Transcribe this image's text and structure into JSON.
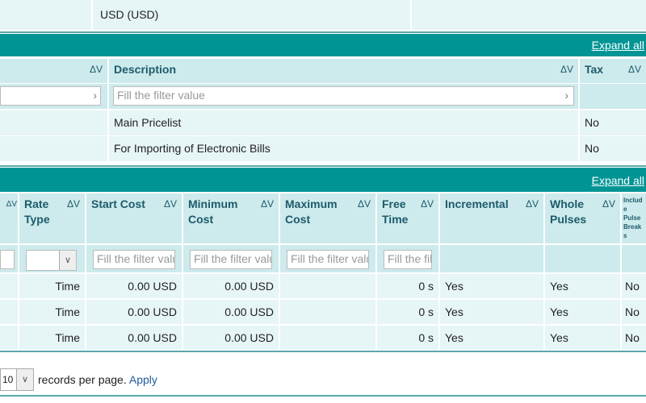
{
  "top": {
    "currency": "USD (USD)"
  },
  "pricelists": {
    "expand_all": "Expand all",
    "sort_icon": "ΔV",
    "columns": [
      "",
      "Description",
      "Tax"
    ],
    "filter_placeholder": "Fill the filter value",
    "rows": [
      {
        "description": "Main Pricelist",
        "tax": "No"
      },
      {
        "description": "For Importing of Electronic Bills",
        "tax": "No"
      }
    ]
  },
  "rates": {
    "expand_all": "Expand all",
    "sort_icon": "ΔV",
    "columns": [
      "",
      "Rate Type",
      "Start Cost",
      "Minimum Cost",
      "Maximum Cost",
      "Free Time",
      "Incremental",
      "Whole Pulses",
      "Include Pulse Breaks"
    ],
    "filter_placeholder": "Fill the filter value",
    "rows": [
      {
        "rate_type": "Time",
        "start_cost": "0.00 USD",
        "min_cost": "0.00 USD",
        "max_cost": "",
        "free_time": "0 s",
        "incremental": "Yes",
        "whole_pulses": "Yes",
        "incl": "No"
      },
      {
        "rate_type": "Time",
        "start_cost": "0.00 USD",
        "min_cost": "0.00 USD",
        "max_cost": "",
        "free_time": "0 s",
        "incremental": "Yes",
        "whole_pulses": "Yes",
        "incl": "No"
      },
      {
        "rate_type": "Time",
        "start_cost": "0.00 USD",
        "min_cost": "0.00 USD",
        "max_cost": "",
        "free_time": "0 s",
        "incremental": "Yes",
        "whole_pulses": "Yes",
        "incl": "No"
      }
    ]
  },
  "pagination": {
    "per_page_value": "10",
    "label": "records per page.",
    "apply": "Apply"
  }
}
